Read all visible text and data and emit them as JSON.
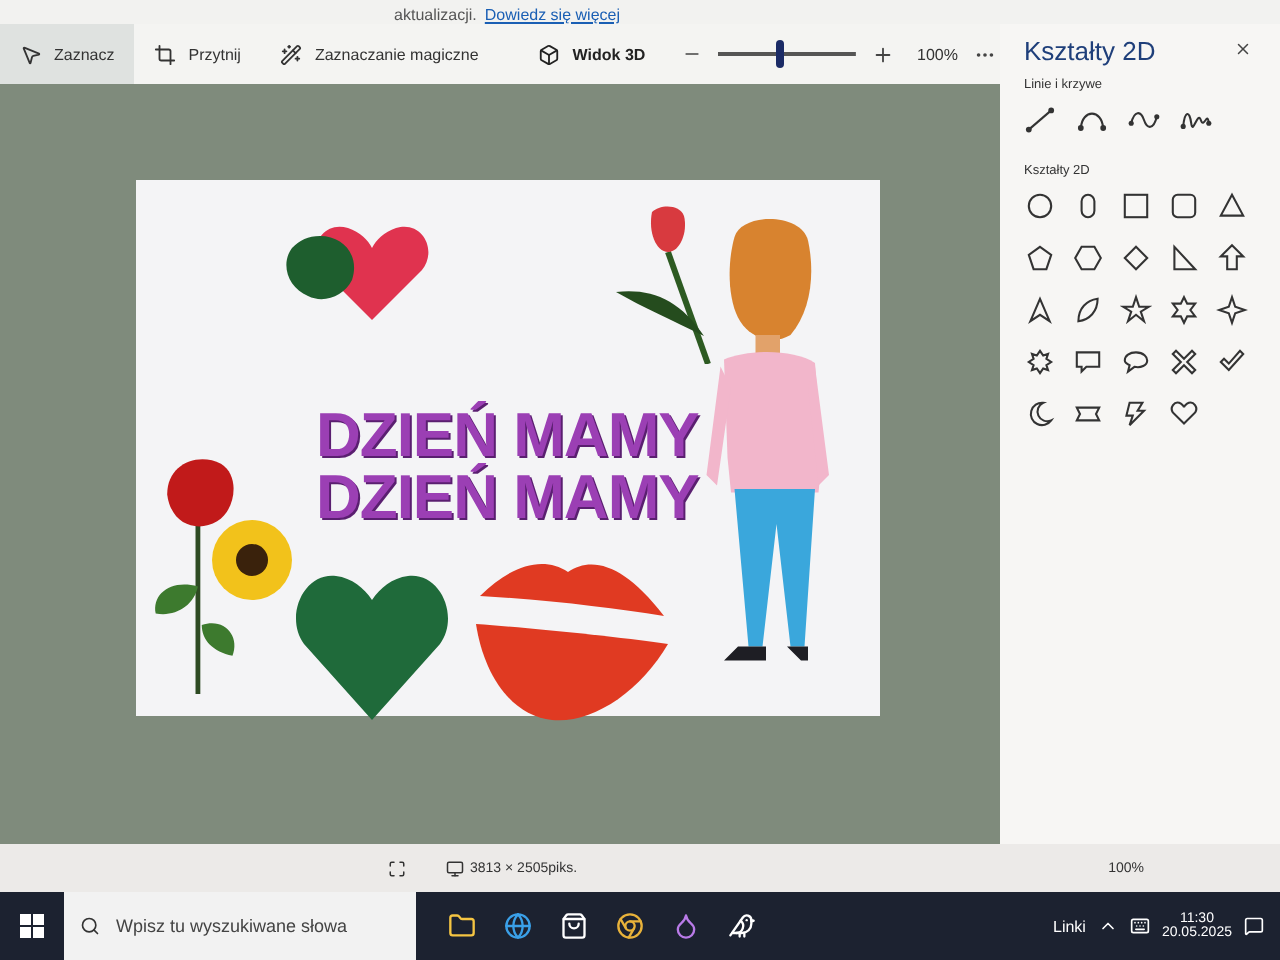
{
  "notice": {
    "text": "aktualizacji.",
    "link": "Dowiedz się więcej"
  },
  "toolbar": {
    "tools": [
      {
        "label": "Zaznacz",
        "kind": "select",
        "selected": true
      },
      {
        "label": "Przytnij",
        "kind": "crop",
        "selected": false
      },
      {
        "label": "Zaznaczanie magiczne",
        "kind": "magic",
        "selected": false
      }
    ],
    "view3d": {
      "label": "Widok 3D",
      "on": false
    },
    "zoom": {
      "level": 0.45,
      "reading": "100%"
    }
  },
  "canvas": {
    "texts": [
      "DZIEŃ MAMY",
      "DZIEŃ MAMY"
    ]
  },
  "panel": {
    "title": "Kształty 2D",
    "sections": [
      {
        "title": "Linie i krzywe",
        "kind": "lines"
      },
      {
        "title": "Kształty 2D",
        "kind": "shapes"
      }
    ]
  },
  "status_bar": {
    "size": "3813 × 2505piks.",
    "zoom": "100%"
  },
  "taskbar": {
    "search": {
      "placeholder": "Wpisz tu wyszukiwane słowa"
    },
    "links": "Linki",
    "time": "11:30",
    "date": "20.05.2025"
  }
}
